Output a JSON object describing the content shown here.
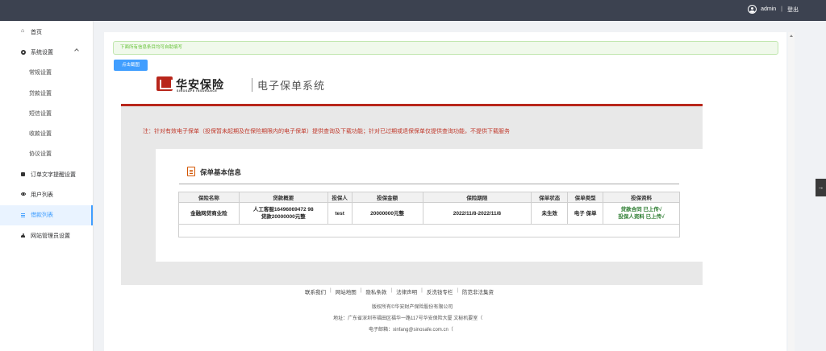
{
  "header": {
    "username": "admin",
    "logout": "登出"
  },
  "sidebar": {
    "items": [
      {
        "label": "首页",
        "icon": "home-icon"
      },
      {
        "label": "系统设置",
        "icon": "gear-icon"
      },
      {
        "label": "常规设置"
      },
      {
        "label": "贷款设置"
      },
      {
        "label": "短信设置"
      },
      {
        "label": "收款设置"
      },
      {
        "label": "协议设置"
      },
      {
        "label": "订单文字提醒设置",
        "icon": "square-icon"
      },
      {
        "label": "用户列表",
        "icon": "eye-icon"
      },
      {
        "label": "借款列表",
        "icon": "list-icon"
      },
      {
        "label": "网站管理员设置",
        "icon": "person-icon"
      }
    ]
  },
  "main": {
    "alert": "下面所有信息条目均可自助填写",
    "screenshot_button": "点击截图"
  },
  "doc": {
    "brand_cn": "华安保险",
    "brand_en": "SINOSAFE INSURANCE",
    "system_name": "电子保单系统",
    "notice": "注：针对有效电子保单（投保暂未起期及在保险期限内的电子保单）提供查询及下载功能；针对已过期或退保保单仅提供查询功能，不提供下载服务",
    "section_title": "保单基本信息",
    "table": {
      "headers": [
        "保险名称",
        "贷款概要",
        "投保人",
        "投保金额",
        "保险期限",
        "保单状态",
        "保单类型",
        "投保资料"
      ],
      "row": {
        "name": "金融网贷商业险",
        "summary_1": "人工客服16496069472 98",
        "summary_2": "贷款20000000元整",
        "holder": "test",
        "amount": "20000000元整",
        "period": "2022/11/8-2022/11/8",
        "status": "未生效",
        "type": "电子 保单",
        "material_1": "贷款合同 已上传√",
        "material_2": "投保人资料 已上传√"
      }
    }
  },
  "footer": {
    "links": [
      "联系我们",
      "网站地图",
      "隐私条款",
      "法律声明",
      "反洗钱专栏",
      "防范非法集资"
    ],
    "copyright": "版权所有©华安财产保险股份有限公司",
    "address": "地址：广东省深圳市福田区福华一路117号华安保险大厦 文秘机要室（",
    "email": "电子邮箱：xinfang@sinosafe.com.cn（"
  }
}
